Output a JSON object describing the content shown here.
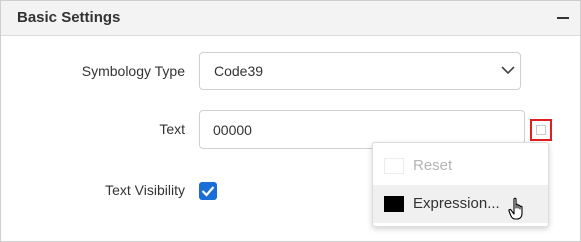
{
  "header": {
    "title": "Basic Settings",
    "collapse_icon": "minus-icon"
  },
  "fields": {
    "symbology": {
      "label": "Symbology Type",
      "value": "Code39"
    },
    "text": {
      "label": "Text",
      "value": "00000"
    },
    "visibility": {
      "label": "Text Visibility",
      "checked": true
    }
  },
  "menu": {
    "items": [
      {
        "label": "Reset",
        "disabled": true,
        "swatch": "#ffffff"
      },
      {
        "label": "Expression...",
        "disabled": false,
        "swatch": "#000000"
      }
    ]
  },
  "colors": {
    "accent": "#1a6fd7",
    "highlight_border": "#e0201f",
    "header_bg": "#f3f3f3"
  }
}
